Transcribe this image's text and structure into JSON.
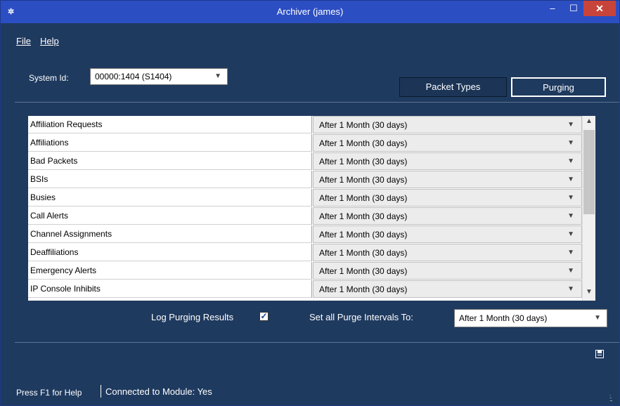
{
  "window": {
    "title": "Archiver (james)",
    "minimize": "–",
    "maximize": "☐",
    "close": "✕"
  },
  "menu": {
    "file": "File",
    "help": "Help"
  },
  "system": {
    "label": "System Id:",
    "value": "00000:1404 (S1404)"
  },
  "tabs": {
    "packet_types": "Packet Types",
    "purging": "Purging"
  },
  "grid": {
    "rows": [
      {
        "name": "Affiliation Requests",
        "interval": "After 1 Month (30 days)"
      },
      {
        "name": "Affiliations",
        "interval": "After 1 Month (30 days)"
      },
      {
        "name": "Bad Packets",
        "interval": "After 1 Month (30 days)"
      },
      {
        "name": "BSIs",
        "interval": "After 1 Month (30 days)"
      },
      {
        "name": "Busies",
        "interval": "After 1 Month (30 days)"
      },
      {
        "name": "Call Alerts",
        "interval": "After 1 Month (30 days)"
      },
      {
        "name": "Channel Assignments",
        "interval": "After 1 Month (30 days)"
      },
      {
        "name": "Deaffiliations",
        "interval": "After 1 Month (30 days)"
      },
      {
        "name": "Emergency Alerts",
        "interval": "After 1 Month (30 days)"
      },
      {
        "name": "IP Console Inhibits",
        "interval": "After 1 Month (30 days)"
      }
    ]
  },
  "options": {
    "log_label": "Log Purging Results",
    "log_checked": true,
    "setall_label": "Set all Purge Intervals To:",
    "setall_value": "After 1 Month (30 days)"
  },
  "status": {
    "help_text": "Press F1 for Help",
    "connection": "Connected to Module: Yes"
  },
  "icons": {
    "app": "app-icon",
    "save": "save-icon",
    "dropdown": "chevron-down-icon"
  },
  "colors": {
    "titlebar": "#2c4ec3",
    "window_bg": "#1f3a5f",
    "close_button": "#c7443a"
  }
}
